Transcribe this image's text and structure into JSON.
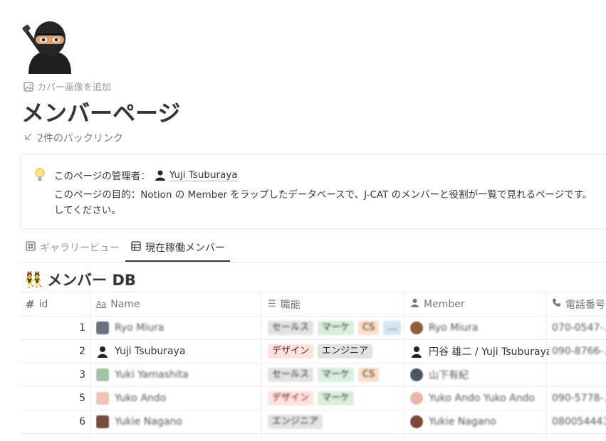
{
  "page": {
    "icon_name": "ninja-icon",
    "add_cover_label": "カバー画像を追加",
    "title": "メンバーページ",
    "backlinks_label": "2件のバックリンク"
  },
  "callout": {
    "icon_name": "light-bulb-icon",
    "admin_label": "このページの管理者：",
    "admin_name": "Yuji Tsuburaya",
    "purpose_line1": "このページの目的：Notion の Member をラップしたデータベースで、J-CAT のメンバーと役割が一覧で見れるページです。",
    "purpose_line2": "してください。"
  },
  "tabs": [
    {
      "label": "ギャラリービュー",
      "icon_name": "gallery-icon"
    },
    {
      "label": "現在稼働メンバー",
      "icon_name": "table-icon",
      "active": true
    }
  ],
  "database": {
    "title_emoji": "👯",
    "title": "メンバー DB",
    "columns": {
      "id": "id",
      "name": "Name",
      "role": "職能",
      "member": "Member",
      "phone": "電話番号"
    },
    "rows": [
      {
        "id": "1",
        "name": "Ryo Miura",
        "blurred": true,
        "roles": [
          {
            "label": "セールス",
            "color": "gray"
          },
          {
            "label": "マーケ",
            "color": "green"
          },
          {
            "label": "CS",
            "color": "orange"
          },
          {
            "label": "…",
            "color": "blue"
          }
        ],
        "member": "Ryo Miura",
        "phone": "070-0547-…"
      },
      {
        "id": "2",
        "name": "Yuji Tsuburaya",
        "blurred": false,
        "roles": [
          {
            "label": "デザイン",
            "color": "red"
          },
          {
            "label": "エンジニア",
            "color": "gray"
          }
        ],
        "member": "円谷 雄二 / Yuji Tsuburaya",
        "phone": "090-8766-…"
      },
      {
        "id": "3",
        "name": "Yuki Yamashita",
        "blurred": true,
        "roles": [
          {
            "label": "セールス",
            "color": "gray"
          },
          {
            "label": "マーケ",
            "color": "green"
          },
          {
            "label": "CS",
            "color": "orange"
          }
        ],
        "member": "山下有紀",
        "phone": ""
      },
      {
        "id": "5",
        "name": "Yuko Ando",
        "blurred": true,
        "roles": [
          {
            "label": "デザイン",
            "color": "red"
          },
          {
            "label": "マーケ",
            "color": "green"
          }
        ],
        "member": "Yuko Ando  Yuko Ando",
        "phone": "090-5778-…"
      },
      {
        "id": "6",
        "name": "Yukie Nagano",
        "blurred": true,
        "roles": [
          {
            "label": "エンジニア",
            "color": "gray"
          }
        ],
        "member": "Yukie Nagano",
        "phone": "080054443…"
      }
    ]
  },
  "colors": {
    "text": "#37352f",
    "muted": "#9b9a97",
    "border": "#e9e9e7"
  }
}
